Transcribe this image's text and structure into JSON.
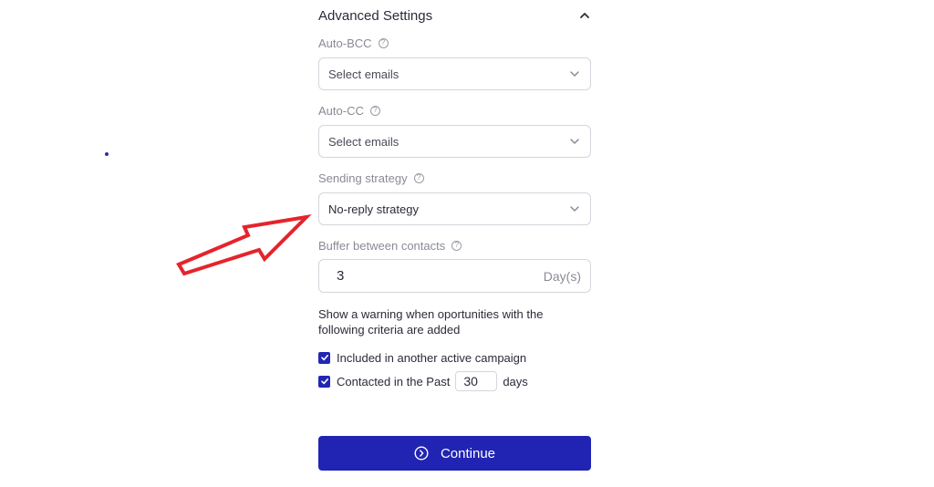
{
  "advanced_settings": {
    "title": "Advanced Settings"
  },
  "auto_bcc": {
    "label": "Auto-BCC",
    "placeholder": "Select emails"
  },
  "auto_cc": {
    "label": "Auto-CC",
    "placeholder": "Select emails"
  },
  "sending_strategy": {
    "label": "Sending strategy",
    "value": "No-reply strategy"
  },
  "buffer": {
    "label": "Buffer between contacts",
    "value": "3",
    "unit": "Day(s)"
  },
  "warning": {
    "text": "Show a warning when oportunities with the following criteria are added",
    "options": [
      {
        "label": "Included in another active campaign",
        "checked": true
      },
      {
        "label": "Contacted in the Past",
        "checked": true,
        "days_value": "30",
        "suffix": "days"
      }
    ]
  },
  "continue_button": {
    "label": "Continue"
  },
  "colors": {
    "primary": "#2124b3",
    "arrow": "#e5242c"
  }
}
